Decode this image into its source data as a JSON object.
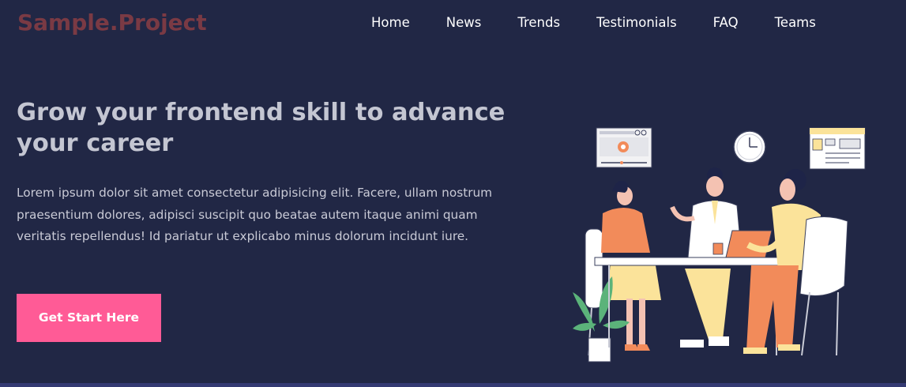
{
  "header": {
    "logo": "Sample.Project",
    "nav": [
      "Home",
      "News",
      "Trends",
      "Testimonials",
      "FAQ",
      "Teams"
    ]
  },
  "hero": {
    "title": "Grow your frontend skill to advance your career",
    "description": "Lorem ipsum dolor sit amet consectetur adipisicing elit. Facere, ullam nostrum praesentium dolores, adipisci suscipit quo beatae autem itaque animi quam veritatis repellendus! Id pariatur ut explicabo minus dolorum incidunt iure.",
    "cta_label": "Get Start Here"
  },
  "colors": {
    "background": "#212745",
    "logo": "#7a3a44",
    "cta": "#ff5b96",
    "heading": "#c4c6d2"
  },
  "illustration": {
    "icons": [
      "video-player-icon",
      "clock-icon",
      "browser-window-icon",
      "plant-icon"
    ]
  }
}
